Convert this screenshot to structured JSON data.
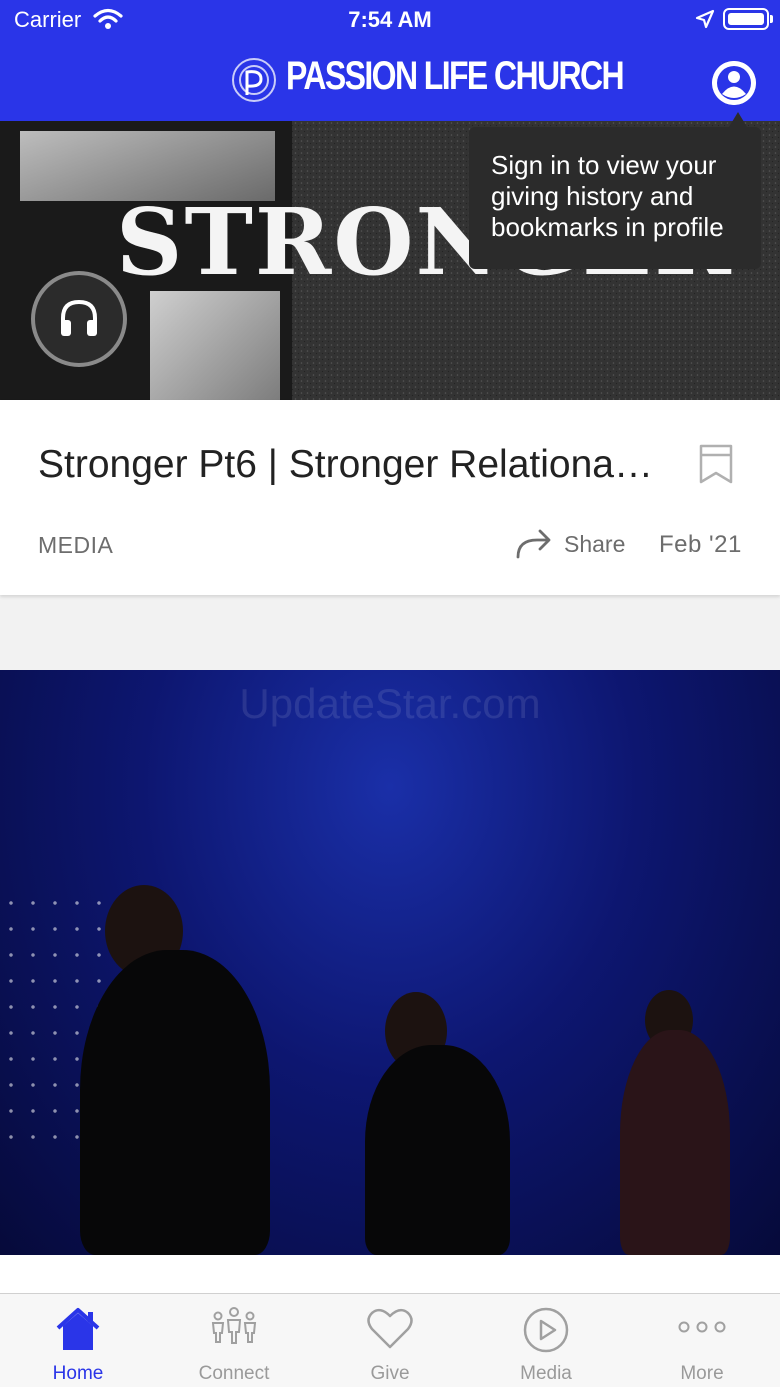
{
  "status_bar": {
    "carrier": "Carrier",
    "time": "7:54 AM"
  },
  "header": {
    "brand": "PASSION LIFE CHURCH",
    "profile_icon": "person-circle-icon"
  },
  "tooltip": {
    "text": "Sign in to view your giving history and bookmarks in profile"
  },
  "hero": {
    "artwork_text": "STRONGER",
    "play_icon": "headphones-icon"
  },
  "card": {
    "title": "Stronger Pt6 | Stronger Relational…",
    "category": "MEDIA",
    "share_label": "Share",
    "date": "Feb '21",
    "bookmark_icon": "bookmark-icon",
    "share_icon": "share-arrow-icon"
  },
  "second_item": {
    "watermark": "UpdateStar.com"
  },
  "tabs": [
    {
      "label": "Home",
      "icon": "home-icon",
      "active": true
    },
    {
      "label": "Connect",
      "icon": "people-icon",
      "active": false
    },
    {
      "label": "Give",
      "icon": "heart-icon",
      "active": false
    },
    {
      "label": "Media",
      "icon": "play-circle-icon",
      "active": false
    },
    {
      "label": "More",
      "icon": "more-dots-icon",
      "active": false
    }
  ],
  "colors": {
    "brand_blue": "#2a35e8",
    "tooltip_bg": "#2b2b2b",
    "inactive_tab": "#9a9a9a"
  }
}
